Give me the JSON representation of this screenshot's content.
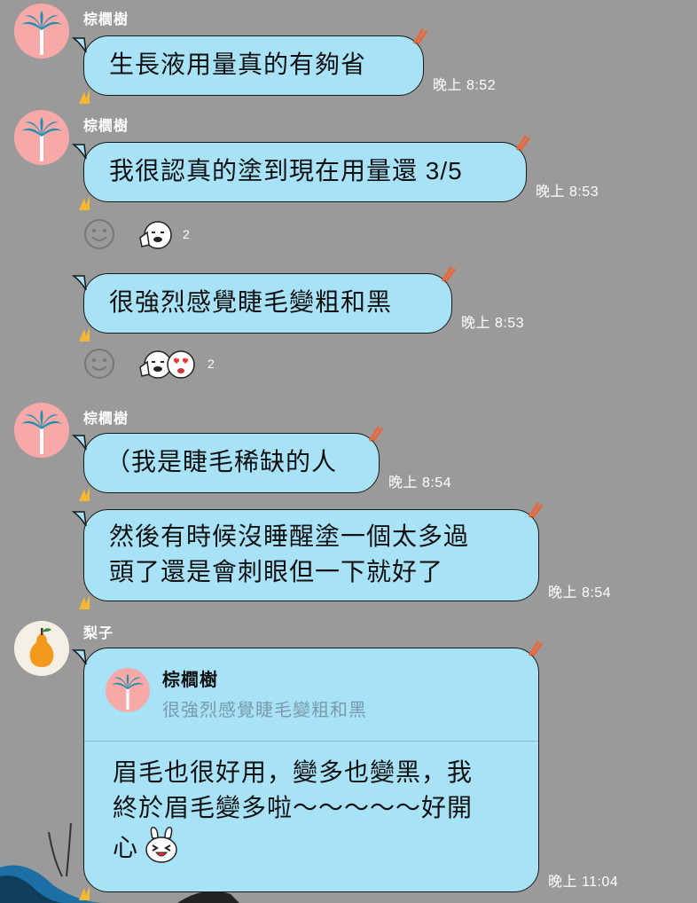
{
  "messages": [
    {
      "sender": "棕櫚樹",
      "text": "生長液用量真的有夠省",
      "time": "晚上 8:52"
    },
    {
      "sender": "棕櫚樹",
      "text": "我很認真的塗到現在用量還 3/5",
      "time": "晚上 8:53",
      "reactions": {
        "count": "2"
      }
    },
    {
      "text": "很強烈感覺睫毛變粗和黑",
      "time": "晚上 8:53",
      "reactions": {
        "count": "2"
      }
    },
    {
      "sender": "棕櫚樹",
      "text": "（我是睫毛稀缺的人",
      "time": "晚上 8:54"
    },
    {
      "text_lines": [
        "然後有時候沒睡醒塗一個太多過",
        "頭了還是會刺眼但一下就好了"
      ],
      "time": "晚上 8:54"
    },
    {
      "sender": "梨子",
      "quote": {
        "sender": "棕櫚樹",
        "text": "很強烈感覺睫毛變粗和黑"
      },
      "text_lines": [
        "眉毛也很好用，變多也變黑，我",
        "終於眉毛變多啦～～～～～好開",
        "心"
      ],
      "time": "晚上 11:04"
    }
  ],
  "colors": {
    "background": "#9a9a9a",
    "bubble": "#a8e2f7",
    "palm_avatar_bg": "#f7a9a8",
    "pear_avatar_bg": "#f3efe4"
  },
  "icons": [
    "palm-tree-icon",
    "pear-icon",
    "smile-icon",
    "sticker-reaction-icon"
  ]
}
